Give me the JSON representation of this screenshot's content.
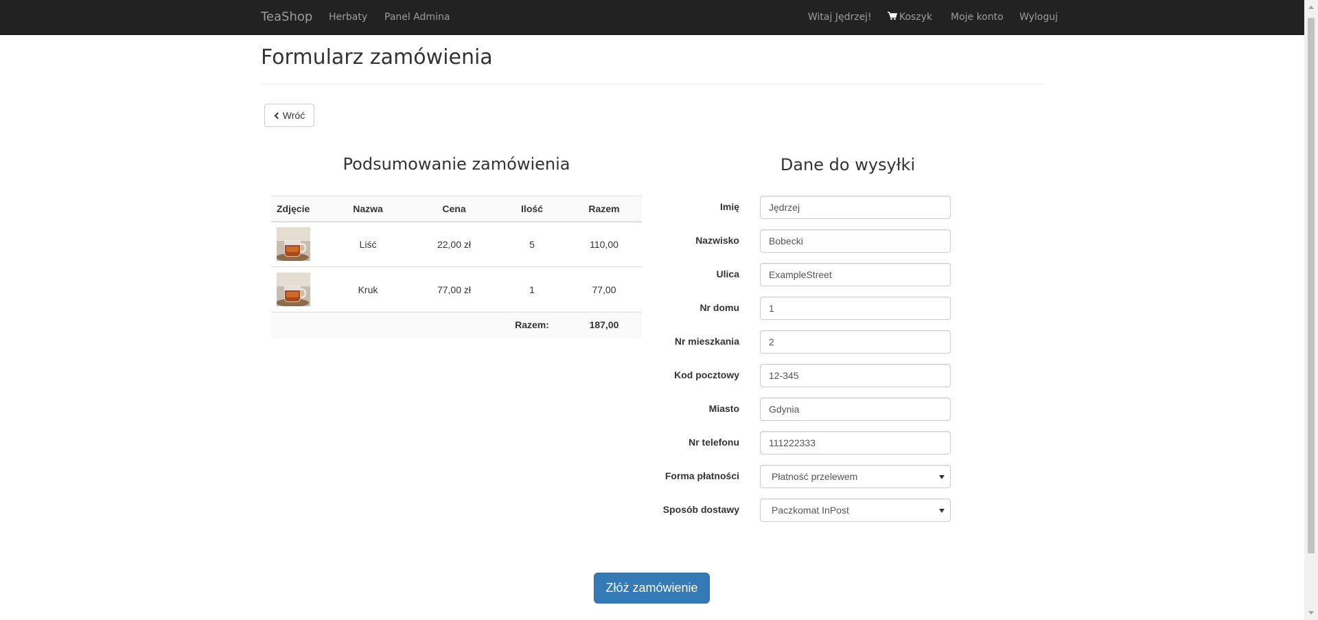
{
  "navbar": {
    "brand": "TeaShop",
    "left_links": [
      "Herbaty",
      "Panel Admina"
    ],
    "greeting": "Witaj Jędrzej!",
    "cart": "Koszyk",
    "account": "Moje konto",
    "logout": "Wyloguj"
  },
  "page": {
    "title": "Formularz zamówienia",
    "back_label": "Wróć"
  },
  "summary": {
    "heading": "Podsumowanie zamówienia",
    "columns": [
      "Zdjęcie",
      "Nazwa",
      "Cena",
      "Ilość",
      "Razem"
    ],
    "rows": [
      {
        "name": "Liść",
        "price": "22,00 zł",
        "qty": "5",
        "total": "110,00"
      },
      {
        "name": "Kruk",
        "price": "77,00 zł",
        "qty": "1",
        "total": "77,00"
      }
    ],
    "footer_label": "Razem:",
    "footer_total": "187,00"
  },
  "shipping": {
    "heading": "Dane do wysyłki",
    "fields": [
      {
        "label": "Imię",
        "value": "Jędrzej"
      },
      {
        "label": "Nazwisko",
        "value": "Bobecki"
      },
      {
        "label": "Ulica",
        "value": "ExampleStreet"
      },
      {
        "label": "Nr domu",
        "value": "1"
      },
      {
        "label": "Nr mieszkania",
        "value": "2"
      },
      {
        "label": "Kod pocztowy",
        "value": "12-345"
      },
      {
        "label": "Miasto",
        "value": "Gdynia"
      },
      {
        "label": "Nr telefonu",
        "value": "111222333"
      }
    ],
    "payment": {
      "label": "Forma płatności",
      "selected": "Płatność przelewem"
    },
    "delivery": {
      "label": "Sposób dostawy",
      "selected": "Paczkomat InPost"
    }
  },
  "submit_label": "Złóż zamówienie",
  "colors": {
    "navbar_bg": "#222222",
    "primary": "#337ab7",
    "navbar_text": "#9d9d9d"
  }
}
